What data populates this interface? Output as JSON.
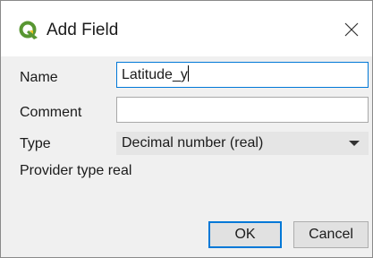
{
  "window": {
    "title": "Add Field",
    "logo_icon": "qgis-logo-icon",
    "close_icon": "close-icon"
  },
  "form": {
    "name_label": "Name",
    "name_value": "Latitude_y",
    "comment_label": "Comment",
    "comment_value": "",
    "type_label": "Type",
    "type_value": "Decimal number (real)",
    "provider_type_text": "Provider type real"
  },
  "buttons": {
    "ok_label": "OK",
    "cancel_label": "Cancel"
  },
  "colors": {
    "focus_border": "#0078d7",
    "qgis_green": "#589632",
    "qgis_yellow": "#f0c21c"
  }
}
